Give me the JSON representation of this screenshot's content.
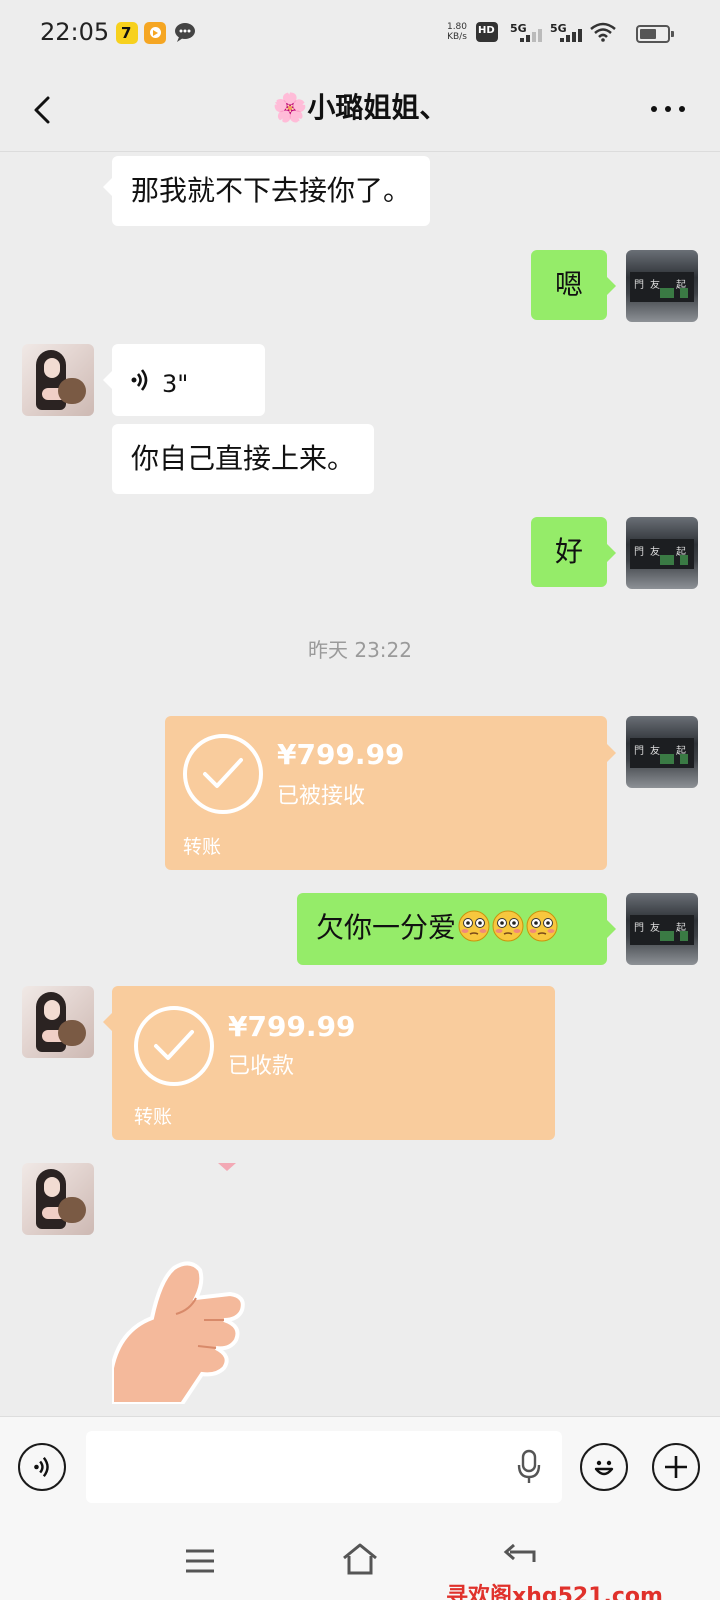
{
  "status_bar": {
    "time": "22:05",
    "net_speed_value": "1.80",
    "net_speed_unit": "KB/s",
    "hd_label": "HD",
    "sim1_label": "5G",
    "sim2_label": "5G",
    "icons": [
      "app-icon-7",
      "app-icon-video",
      "chat-bubble-icon",
      "signal-icon",
      "wifi-icon",
      "battery-icon"
    ]
  },
  "header": {
    "title": "🌸小璐姐姐、",
    "back_icon": "chevron-left-icon",
    "more_icon": "more-dots-icon"
  },
  "messages": [
    {
      "side": "left",
      "type": "text",
      "text": "那我就不下去接你了。"
    },
    {
      "side": "right",
      "type": "text",
      "text": "嗯"
    },
    {
      "side": "left",
      "type": "voice",
      "duration": "3\""
    },
    {
      "side": "left",
      "type": "text",
      "text": "你自己直接上来。"
    },
    {
      "side": "right",
      "type": "text",
      "text": "好"
    },
    {
      "type": "timestamp",
      "text": "昨天 23:22"
    },
    {
      "side": "right",
      "type": "transfer",
      "amount": "¥799.99",
      "state": "已被接收",
      "label": "转账"
    },
    {
      "side": "right",
      "type": "text",
      "text": "欠你一分爱",
      "emoji": [
        "flushed-face",
        "flushed-face",
        "flushed-face"
      ]
    },
    {
      "side": "left",
      "type": "transfer",
      "amount": "¥799.99",
      "state": "已收款",
      "label": "转账"
    },
    {
      "side": "left",
      "type": "sticker",
      "sticker": "thumbs-up-hand"
    }
  ],
  "input_bar": {
    "voice_icon": "voice-toggle-icon",
    "input_value": "",
    "mic_icon": "microphone-icon",
    "emoji_icon": "smiley-icon",
    "plus_icon": "plus-icon"
  },
  "nav_bar": {
    "icons": [
      "menu-icon",
      "home-icon",
      "back-arrow-icon"
    ],
    "watermark": "寻欢阁xhg521.com"
  },
  "colors": {
    "background": "#ededed",
    "bubble_left": "#ffffff",
    "bubble_right": "#95ec69",
    "transfer": "#f9cc9d",
    "timestamp": "#9a9a9a"
  }
}
